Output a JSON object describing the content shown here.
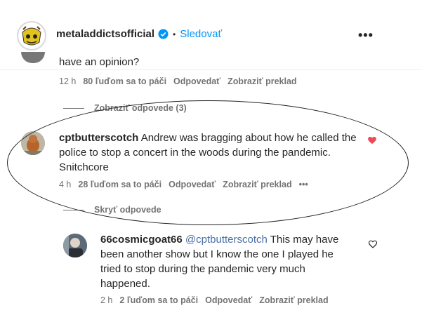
{
  "header": {
    "username": "metaladdictsofficial",
    "separator": "•",
    "follow_label": "Sledovať",
    "more_label": "•••"
  },
  "previous_comment": {
    "text_tail": "have an opinion?",
    "time": "12 h",
    "likes": "80 ľuďom sa to páči",
    "reply_label": "Odpovedať",
    "translate_label": "Zobraziť preklad"
  },
  "view_replies_label": "Zobraziť odpovede (3)",
  "comment": {
    "username": "cptbutterscotch",
    "text": "Andrew was bragging about how he called the police to stop a concert in the woods during the pandemic. Snitchcore",
    "time": "4 h",
    "likes": "28 ľuďom sa to páči",
    "reply_label": "Odpovedať",
    "translate_label": "Zobraziť preklad",
    "more_label": "•••",
    "liked": true
  },
  "hide_replies_label": "Skryť odpovede",
  "reply": {
    "username": "66cosmicgoat66",
    "mention": "@cptbutterscotch",
    "text": "This may have been another show but I know the one I played he tried to stop during the pandemic very much happened.",
    "time": "2 h",
    "likes": "2 ľuďom sa to páči",
    "reply_label": "Odpovedať",
    "translate_label": "Zobraziť preklad",
    "liked": false
  },
  "colors": {
    "link_blue": "#0095f6",
    "heart_red": "#ed4956",
    "muted": "#737373"
  }
}
